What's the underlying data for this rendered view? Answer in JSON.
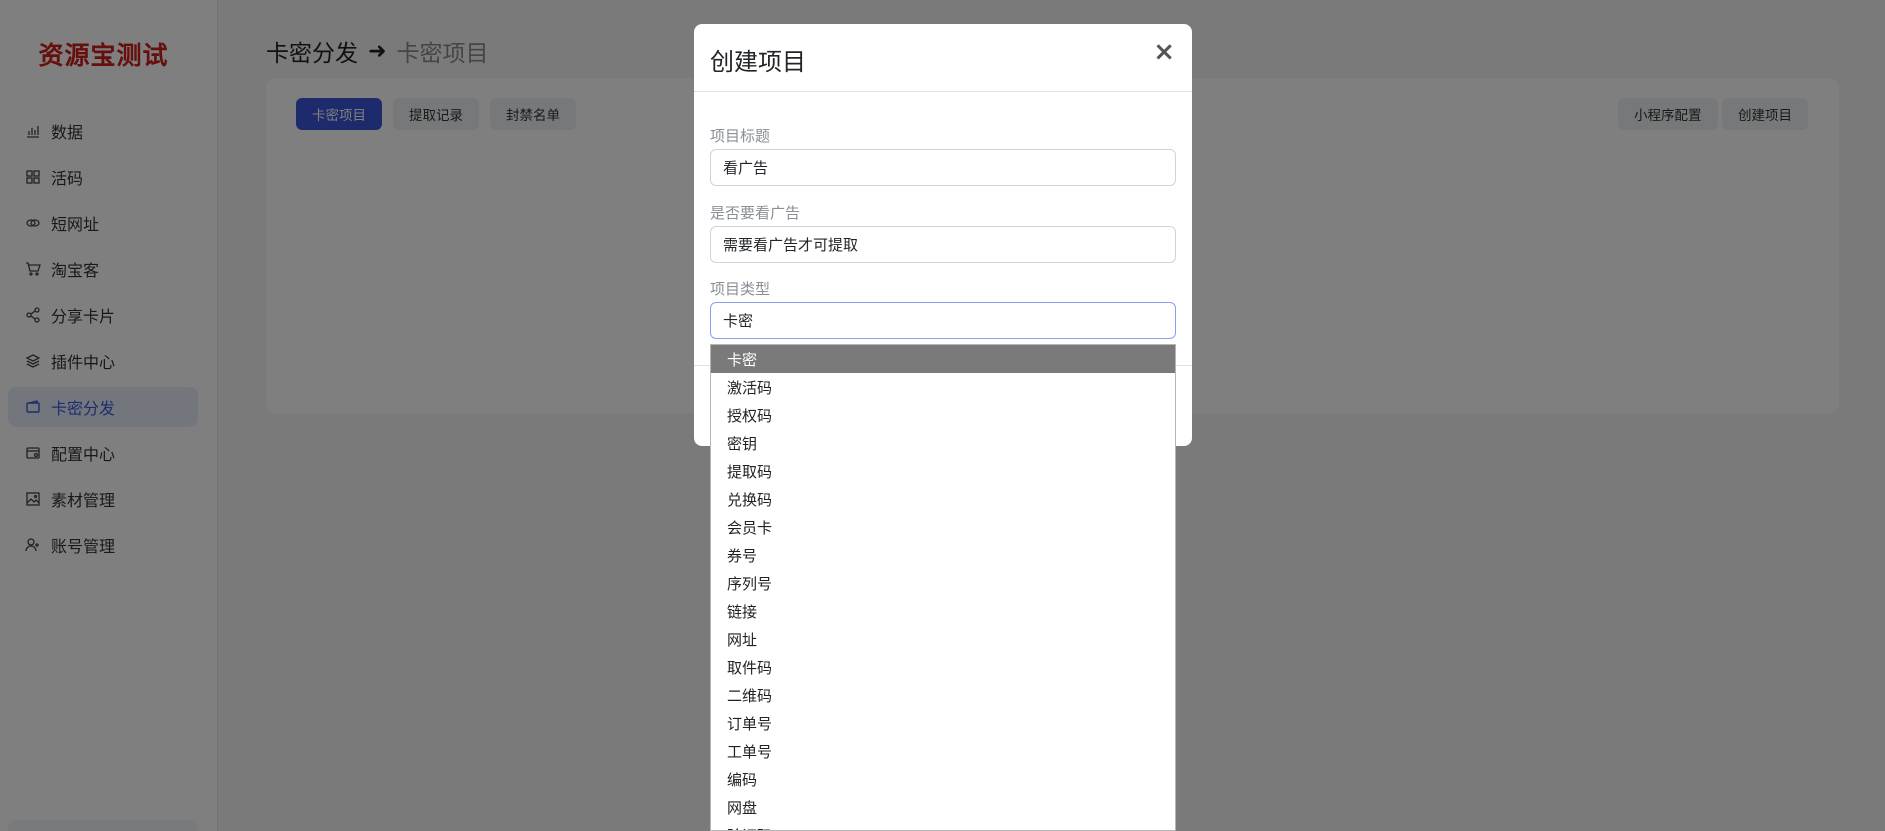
{
  "sidebar": {
    "brand": "资源宝测试",
    "items": [
      {
        "label": "数据",
        "icon": "bar-chart-icon"
      },
      {
        "label": "活码",
        "icon": "grid-icon"
      },
      {
        "label": "短网址",
        "icon": "link-icon"
      },
      {
        "label": "淘宝客",
        "icon": "cart-icon"
      },
      {
        "label": "分享卡片",
        "icon": "share-icon"
      },
      {
        "label": "插件中心",
        "icon": "layers-icon"
      },
      {
        "label": "卡密分发",
        "icon": "card-icon",
        "active": true
      },
      {
        "label": "配置中心",
        "icon": "settings-card-icon"
      },
      {
        "label": "素材管理",
        "icon": "image-icon"
      },
      {
        "label": "账号管理",
        "icon": "user-add-icon"
      }
    ]
  },
  "breadcrumb": {
    "root": "卡密分发",
    "arrow": "➜",
    "current": "卡密项目"
  },
  "tabs": [
    "卡密项目",
    "提取记录",
    "封禁名单"
  ],
  "actions": [
    "小程序配置",
    "创建项目"
  ],
  "modal": {
    "title": "创建项目",
    "close": "×",
    "fields": [
      {
        "label": "项目标题",
        "value": "看广告"
      },
      {
        "label": "是否要看广告",
        "value": "需要看广告才可提取"
      },
      {
        "label": "项目类型",
        "value": "卡密"
      }
    ]
  },
  "dropdown": {
    "selected": "卡密",
    "options": [
      "卡密",
      "激活码",
      "授权码",
      "密钥",
      "提取码",
      "兑换码",
      "会员卡",
      "券号",
      "序列号",
      "链接",
      "网址",
      "取件码",
      "二维码",
      "订单号",
      "工单号",
      "编码",
      "网盘",
      "验证码"
    ]
  },
  "colors": {
    "brand": "#cc1f1a",
    "primary": "#3b55d9",
    "active_nav_bg": "#e8edfb",
    "selected_option": "#7a7a7a"
  }
}
